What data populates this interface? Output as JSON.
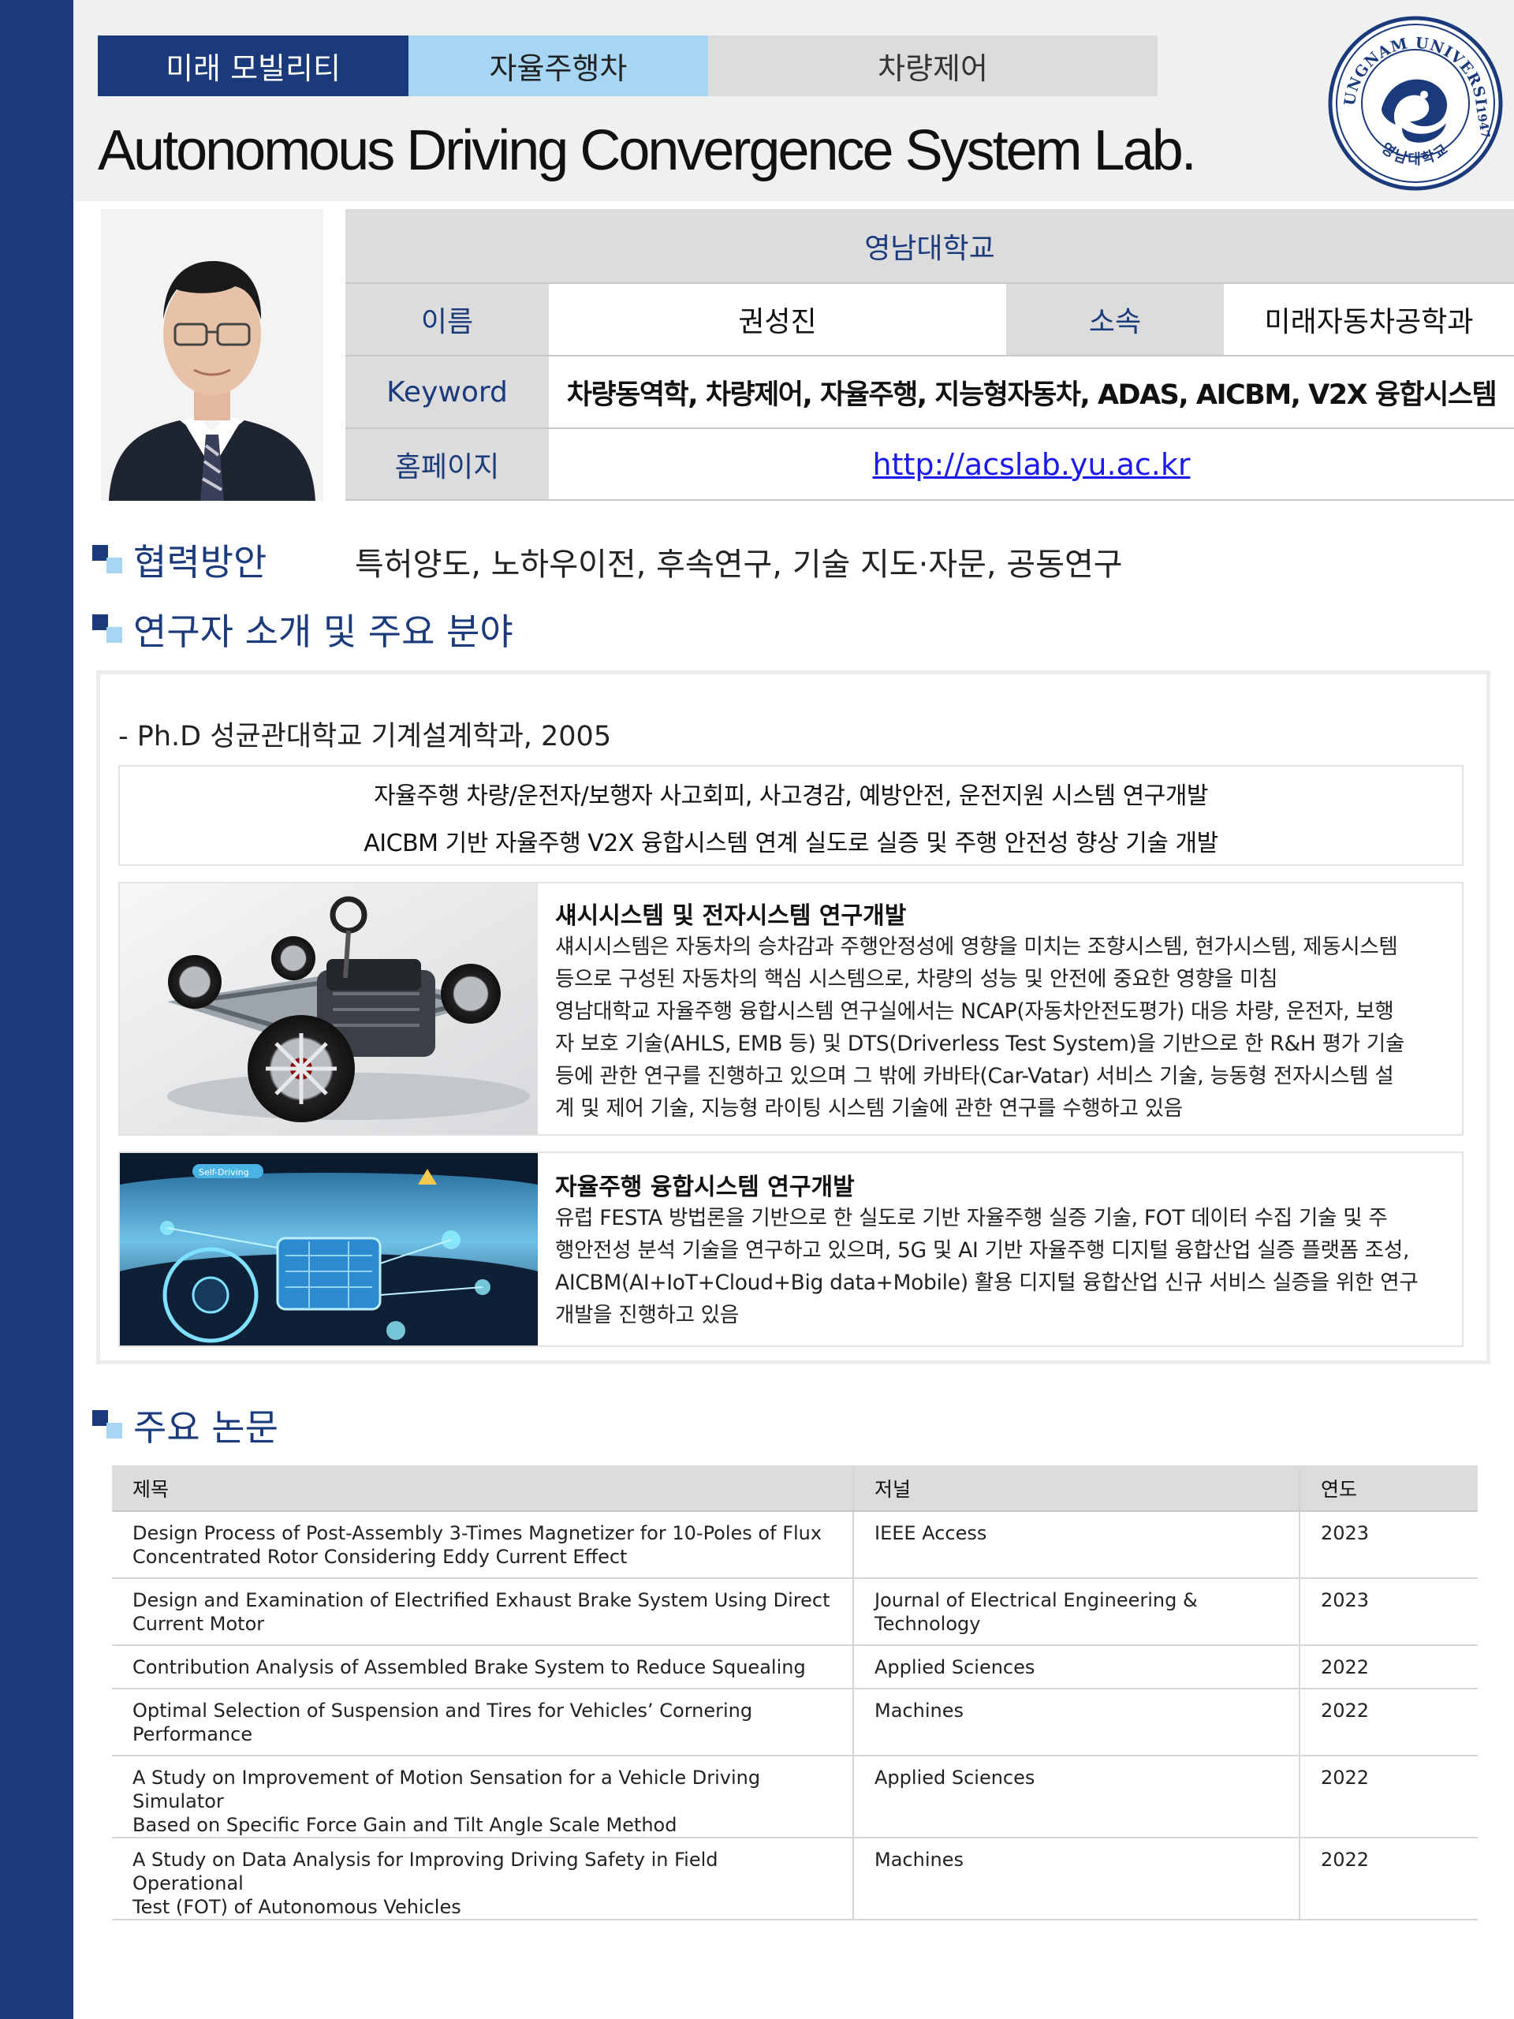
{
  "header": {
    "tabs": [
      "미래 모빌리티",
      "자율주행차",
      "차량제어"
    ],
    "lab_title": "Autonomous Driving Convergence System Lab.",
    "logo": {
      "icon": "university-seal",
      "text_top": "YEUNGNAM UNIVERSITY",
      "text_bottom": "영남대학교",
      "year": "1947"
    }
  },
  "profile": {
    "photo_icon": "portrait-photo",
    "university": "영남대학교",
    "name_label": "이름",
    "name": "권성진",
    "dept_label": "소속",
    "dept": "미래자동차공학과",
    "keyword_label": "Keyword",
    "keywords": "차량동역학, 차량제어, 자율주행, 지능형자동차, ADAS, AICBM, V2X 융합시스템",
    "homepage_label": "홈페이지",
    "homepage": "http://acslab.yu.ac.kr"
  },
  "cooperation": {
    "title": "협력방안",
    "text": "특허양도, 노하우이전, 후속연구, 기술 지도·자문, 공동연구"
  },
  "intro": {
    "title": "연구자 소개 및 주요 분야",
    "degree": "- Ph.D 성균관대학교 기계설계학과, 2005",
    "focus": [
      "자율주행 차량/운전자/보행자 사고회피, 사고경감, 예방안전, 운전지원 시스템 연구개발",
      "AICBM 기반 자율주행 V2X 융합시스템 연계 실도로 실증 및 주행 안전성 향상 기술 개발"
    ],
    "features": [
      {
        "image_icon": "vehicle-chassis-image",
        "title": "섀시시스템 및 전자시스템 연구개발",
        "lines": [
          "섀시시스템은 자동차의 승차감과 주행안정성에 영향을 미치는 조향시스템, 현가시스템, 제동시스템",
          "등으로 구성된 자동차의 핵심 시스템으로, 차량의 성능 및 안전에 중요한 영향을 미침",
          "영남대학교 자율주행 융합시스템 연구실에서는 NCAP(자동차안전도평가) 대응 차량, 운전자, 보행",
          "자 보호 기술(AHLS, EMB 등) 및 DTS(Driverless Test System)을 기반으로 한 R&H 평가 기술",
          "등에 관한 연구를 진행하고 있으며 그 밖에 카바타(Car-Vatar) 서비스 기술, 능동형 전자시스템 설",
          "계 및 제어 기술, 지능형 라이팅 시스템 기술에 관한 연구를 수행하고 있음"
        ]
      },
      {
        "image_icon": "self-driving-cockpit-image",
        "image_label": "Self-Driving",
        "title": "자율주행 융합시스템 연구개발",
        "lines": [
          "유럽 FESTA 방법론을 기반으로 한 실도로 기반 자율주행 실증 기술, FOT 데이터 수집 기술 및 주",
          "행안전성 분석 기술을 연구하고 있으며, 5G 및 AI 기반 자율주행 디지털 융합산업 실증 플랫폼 조성,",
          "AICBM(AI+IoT+Cloud+Big data+Mobile) 활용 디지털 융합산업 신규 서비스 실증을 위한 연구",
          "개발을 진행하고 있음"
        ]
      }
    ]
  },
  "papers": {
    "title": "주요 논문",
    "headers": [
      "제목",
      "저널",
      "연도"
    ],
    "rows": [
      {
        "title": [
          "Design Process of Post-Assembly 3-Times Magnetizer for 10-Poles of Flux",
          "Concentrated Rotor Considering Eddy Current Effect"
        ],
        "journal": [
          "IEEE Access"
        ],
        "year": "2023"
      },
      {
        "title": [
          "Design and Examination of Electrified Exhaust Brake System Using Direct",
          "Current Motor"
        ],
        "journal": [
          "Journal of Electrical Engineering &",
          "Technology"
        ],
        "year": "2023"
      },
      {
        "title": [
          "Contribution Analysis of Assembled Brake System to Reduce Squealing"
        ],
        "journal": [
          "Applied Sciences"
        ],
        "year": "2022"
      },
      {
        "title": [
          "Optimal Selection of Suspension and Tires for Vehicles’ Cornering",
          "Performance"
        ],
        "journal": [
          "Machines"
        ],
        "year": "2022"
      },
      {
        "title": [
          "A Study on Improvement of Motion Sensation for a Vehicle Driving Simulator",
          "Based on Specific Force Gain and Tilt Angle Scale Method"
        ],
        "journal": [
          "Applied Sciences"
        ],
        "year": "2022"
      },
      {
        "title": [
          "A Study on Data Analysis for Improving Driving Safety in Field Operational",
          "Test (FOT) of Autonomous Vehicles"
        ],
        "journal": [
          "Machines"
        ],
        "year": "2022"
      }
    ]
  },
  "colors": {
    "navy": "#1a3a7c",
    "sky": "#a7d6f5",
    "gray": "#dcdcdc",
    "link": "#1a1aee"
  }
}
